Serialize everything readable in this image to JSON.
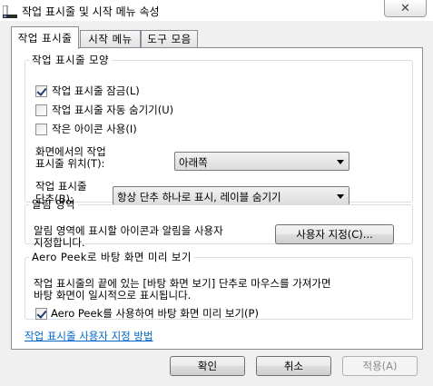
{
  "window": {
    "title": "작업 표시줄 및 시작 메뉴 속성",
    "close_glyph": "✕"
  },
  "tabs": [
    {
      "label": "작업 표시줄",
      "active": true
    },
    {
      "label": "시작 메뉴",
      "active": false
    },
    {
      "label": "도구 모음",
      "active": false
    }
  ],
  "appearance": {
    "legend": "작업 표시줄 모양",
    "options": [
      {
        "label": "작업 표시줄 잠금(L)",
        "checked": true
      },
      {
        "label": "작업 표시줄 자동 숨기기(U)",
        "checked": false
      },
      {
        "label": "작은 아이콘 사용(I)",
        "checked": false
      }
    ],
    "location_label_1": "화면에서의 작업",
    "location_label_2": "표시줄 위치(T):",
    "location_value": "아래쪽",
    "buttons_label_1": "작업 표시줄",
    "buttons_label_2": "단추(B):",
    "buttons_value": "항상 단추 하나로 표시, 레이블 숨기기"
  },
  "notification": {
    "legend": "알림 영역",
    "desc_1": "알림 영역에 표시할 아이콘과 알림을 사용자",
    "desc_2": "지정합니다.",
    "customize_label": "사용자 지정(C)..."
  },
  "peek": {
    "legend": "Aero Peek로 바탕 화면 미리 보기",
    "desc_1": "작업 표시줄의 끝에 있는 [바탕 화면 보기] 단추로 마우스를 가져가면",
    "desc_2": "바탕 화면이 일시적으로 표시됩니다.",
    "option_label": "Aero Peek를 사용하여 바탕 화면 미리 보기(P)",
    "option_checked": true
  },
  "help_link": "작업 표시줄 사용자 지정 방법",
  "footer": {
    "ok": "확인",
    "cancel": "취소",
    "apply": "적용(A)"
  },
  "colors": {
    "dialog_bg": "#f0f0f0",
    "link": "#0066cc",
    "group_border": "#d5dfe5"
  }
}
